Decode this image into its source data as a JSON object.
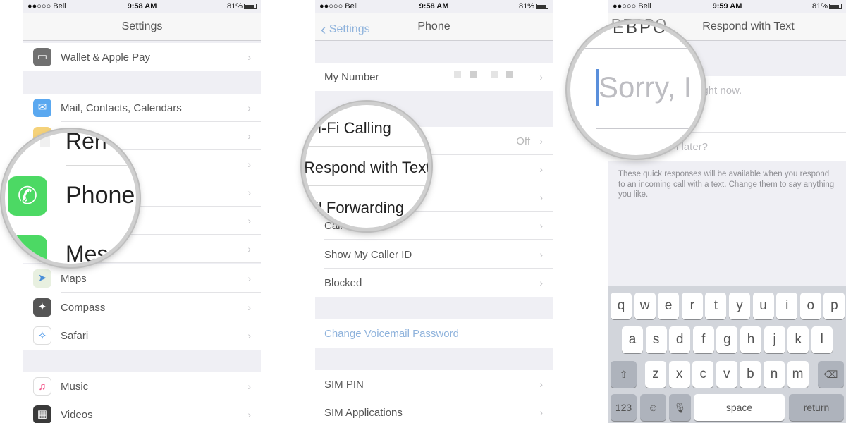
{
  "panel1": {
    "status": {
      "carrier": "●●○○○ Bell",
      "time": "9:58 AM",
      "battery": "81%"
    },
    "title": "Settings",
    "rows": [
      {
        "label": "Wallet & Apple Pay"
      },
      {
        "label": "Mail, Contacts, Calendars"
      },
      {
        "label": "Maps"
      },
      {
        "label": "Compass"
      },
      {
        "label": "Safari"
      },
      {
        "label": "Music"
      },
      {
        "label": "Videos"
      }
    ],
    "magnifier": {
      "top_label": "Ren",
      "main_label": "Phone",
      "bottom_label": "Mes"
    }
  },
  "panel2": {
    "status": {
      "carrier": "●●○○○ Bell",
      "time": "9:58 AM",
      "battery": "81%"
    },
    "back": "Settings",
    "title": "Phone",
    "rows": [
      {
        "label": "My Number"
      },
      {
        "value": "Off"
      },
      {
        "label": "Call Waiting"
      },
      {
        "label": "Show My Caller ID"
      },
      {
        "label": "Blocked"
      },
      {
        "label": "Change Voicemail Password"
      },
      {
        "label": "SIM PIN"
      },
      {
        "label": "SIM Applications"
      }
    ],
    "magnifier": {
      "top_label": "i-Fi Calling",
      "main_label": "Respond with Text",
      "bottom_label": "ll Forwarding"
    }
  },
  "panel3": {
    "status": {
      "carrier": "●●○○○ Bell",
      "time": "9:59 AM",
      "battery": "81%"
    },
    "back": "RESPO",
    "title": "Respond with Text",
    "responses": [
      "ight now.",
      "l later?"
    ],
    "footer": "These quick responses will be available when you respond to an incoming call with a text. Change them to say anything you like.",
    "magnifier": {
      "text": "Sorry, I"
    },
    "keyboard": {
      "row1": [
        "q",
        "w",
        "e",
        "r",
        "t",
        "y",
        "u",
        "i",
        "o",
        "p"
      ],
      "row2": [
        "a",
        "s",
        "d",
        "f",
        "g",
        "h",
        "j",
        "k",
        "l"
      ],
      "row3": [
        "z",
        "x",
        "c",
        "v",
        "b",
        "n",
        "m"
      ],
      "numbers": "123",
      "space": "space",
      "return": "return"
    }
  },
  "icons": {
    "wallet": "wallet-icon",
    "mail": "mail-icon",
    "maps": "maps-icon",
    "compass": "compass-icon",
    "safari": "safari-icon",
    "music": "music-icon",
    "videos": "videos-icon",
    "phone": "phone-icon",
    "messages": "messages-icon",
    "reminders": "reminders-icon"
  },
  "colors": {
    "phone_green": "#4cd964",
    "link_blue": "#8fb3dc",
    "background": "#efeff4"
  }
}
